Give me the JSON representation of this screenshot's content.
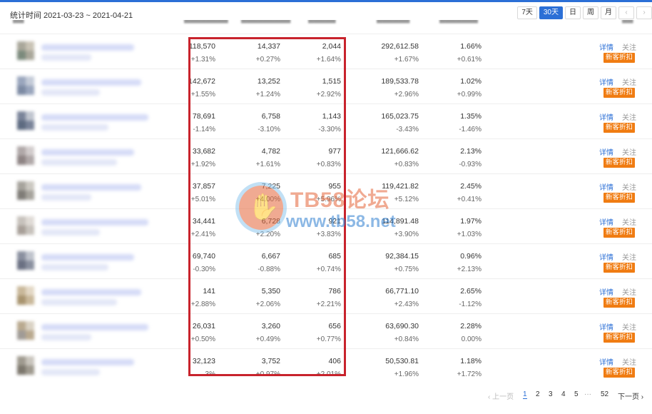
{
  "header": {
    "stat_time": "统计时间 2021-03-23 ~ 2021-04-21",
    "ranges": [
      "7天",
      "30天",
      "日",
      "周",
      "月"
    ],
    "active_range": "30天",
    "prev_arrow": "‹",
    "next_arrow": "›"
  },
  "rows": [
    {
      "c1": "118,570",
      "p1": "+1.31%",
      "c2": "14,337",
      "p2": "+0.27%",
      "c3": "2,044",
      "p3": "+1.64%",
      "c4": "292,612.58",
      "p4": "+1.67%",
      "c5": "1.66%",
      "p5": "+0.61%"
    },
    {
      "c1": "142,672",
      "p1": "+1.55%",
      "c2": "13,252",
      "p2": "+1.24%",
      "c3": "1,515",
      "p3": "+2.92%",
      "c4": "189,533.78",
      "p4": "+2.96%",
      "c5": "1.02%",
      "p5": "+0.99%"
    },
    {
      "c1": "78,691",
      "p1": "-1.14%",
      "c2": "6,758",
      "p2": "-3.10%",
      "c3": "1,143",
      "p3": "-3.30%",
      "c4": "165,023.75",
      "p4": "-3.43%",
      "c5": "1.35%",
      "p5": "-1.46%"
    },
    {
      "c1": "33,682",
      "p1": "+1.92%",
      "c2": "4,782",
      "p2": "+1.61%",
      "c3": "977",
      "p3": "+0.83%",
      "c4": "121,666.62",
      "p4": "+0.83%",
      "c5": "2.13%",
      "p5": "-0.93%"
    },
    {
      "c1": "37,857",
      "p1": "+5.01%",
      "c2": "7,225",
      "p2": "+4.00%",
      "c3": "955",
      "p3": "+5.96%",
      "c4": "119,421.82",
      "p4": "+5.12%",
      "c5": "2.45%",
      "p5": "+0.41%"
    },
    {
      "c1": "34,441",
      "p1": "+2.41%",
      "c2": "6,728",
      "p2": "+2.20%",
      "c3": "921",
      "p3": "+3.83%",
      "c4": "114,891.48",
      "p4": "+3.90%",
      "c5": "1.97%",
      "p5": "+1.03%"
    },
    {
      "c1": "69,740",
      "p1": "-0.30%",
      "c2": "6,667",
      "p2": "-0.88%",
      "c3": "685",
      "p3": "+0.74%",
      "c4": "92,384.15",
      "p4": "+0.75%",
      "c5": "0.96%",
      "p5": "+2.13%"
    },
    {
      "c1": "141",
      "p1": "+2.88%",
      "c2": "5,350",
      "p2": "+2.06%",
      "c3": "786",
      "p3": "+2.21%",
      "c4": "66,771.10",
      "p4": "+2.43%",
      "c5": "2.65%",
      "p5": "-1.12%"
    },
    {
      "c1": "26,031",
      "p1": "+0.50%",
      "c2": "3,260",
      "p2": "+0.49%",
      "c3": "656",
      "p3": "+0.77%",
      "c4": "63,690.30",
      "p4": "+0.84%",
      "c5": "2.28%",
      "p5": "0.00%"
    },
    {
      "c1": "32,123",
      "p1": "3%",
      "c2": "3,752",
      "p2": "+0.97%",
      "c3": "406",
      "p3": "+2.01%",
      "c4": "50,530.81",
      "p4": "+1.96%",
      "c5": "1.18%",
      "p5": "+1.72%"
    }
  ],
  "row_actions": {
    "detail": "详情",
    "follow": "关注",
    "promo": "新客折扣"
  },
  "pager": {
    "prev": "‹ 上一页",
    "pages": [
      "1",
      "2",
      "3",
      "4",
      "5"
    ],
    "ellipsis": "···",
    "last": "52",
    "next": "下一页 ›"
  },
  "watermark": {
    "title": "TB58论坛",
    "url": "www.tb58.net"
  },
  "colors": {
    "accent": "#2b6fd6",
    "promo": "#f07c12",
    "highlight": "#c8232c"
  }
}
